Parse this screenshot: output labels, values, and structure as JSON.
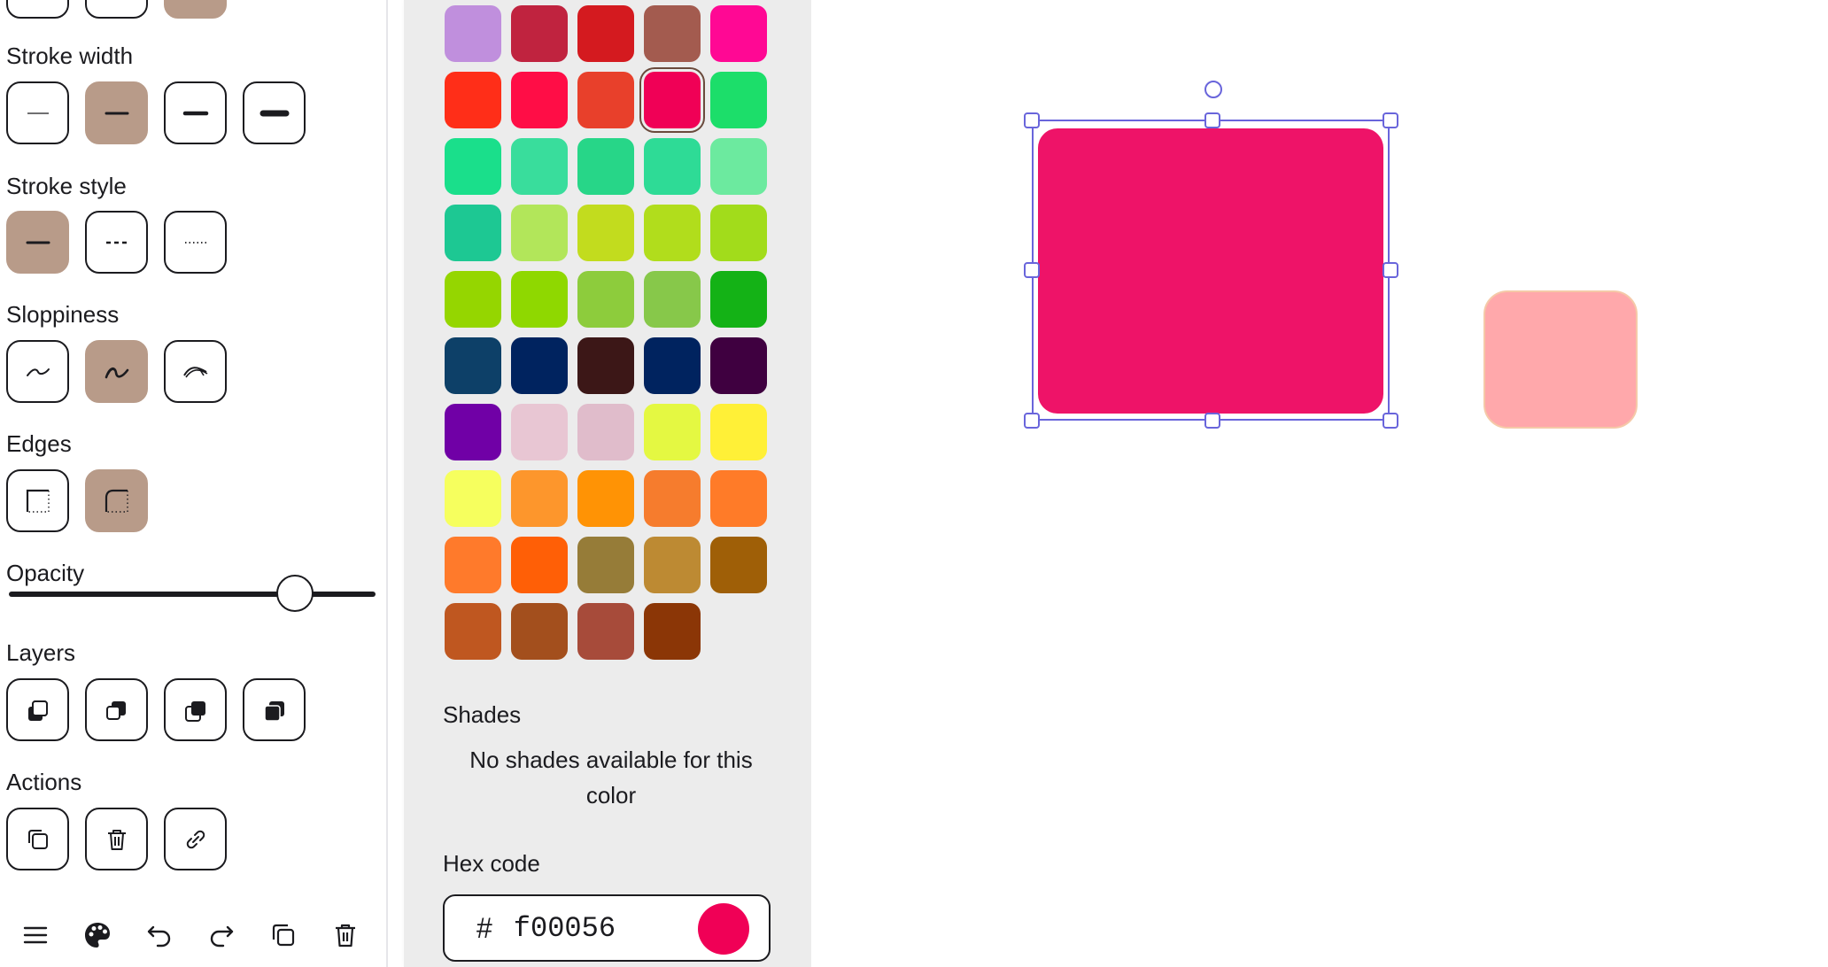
{
  "properties": {
    "stroke_width_label": "Stroke width",
    "stroke_style_label": "Stroke style",
    "sloppiness_label": "Sloppiness",
    "edges_label": "Edges",
    "opacity_label": "Opacity",
    "opacity_value": 0.78,
    "layers_label": "Layers",
    "actions_label": "Actions"
  },
  "picker": {
    "swatches": [
      "#c08fdd",
      "#c0233f",
      "#d41a1f",
      "#a35b4f",
      "#ff0894",
      "#ff2e18",
      "#ff0d46",
      "#e8402b",
      "#f00056",
      "#1cde6a",
      "#1adf8b",
      "#39dd9c",
      "#27d688",
      "#2edb96",
      "#6cea9f",
      "#1dc893",
      "#b2e65a",
      "#c2dc1e",
      "#b1dd1c",
      "#a2dc1b",
      "#95d600",
      "#8fd800",
      "#8dcc3c",
      "#87c84a",
      "#14b216",
      "#0d4068",
      "#00235f",
      "#3c1717",
      "#00235f",
      "#3f0040",
      "#7000a6",
      "#e8c6d3",
      "#e0bccb",
      "#e4f842",
      "#fff037",
      "#f6ff5e",
      "#fd962c",
      "#ff9305",
      "#f67c2d",
      "#ff7b28",
      "#ff7a2b",
      "#ff5f06",
      "#967c38",
      "#bd8a33",
      "#9f5f07",
      "#bf5720",
      "#a34f1d",
      "#a74b3a",
      "#8b3606"
    ],
    "selected_index": 8,
    "shades_label": "Shades",
    "shades_message": "No shades available for this color",
    "hex_label": "Hex code",
    "hex_hash": "#",
    "hex_value": "f00056",
    "hex_color": "#f00056"
  },
  "canvas": {
    "selected_shape_fill": "#ee1368",
    "other_shape_fill": "#ffa8ab",
    "selection_color": "#6965db"
  }
}
